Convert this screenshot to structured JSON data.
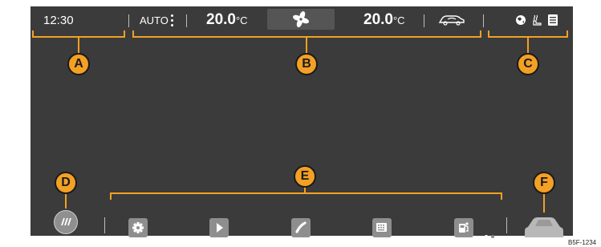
{
  "status_bar": {
    "time": "12:30",
    "auto_label": "AUTO",
    "temp_left_value": "20.0",
    "temp_left_unit": "°C",
    "temp_right_value": "20.0",
    "temp_right_unit": "°C"
  },
  "callouts": {
    "a": "A",
    "b": "B",
    "c": "C",
    "d": "D",
    "e": "E",
    "f": "F"
  },
  "bottom_bar": {
    "apps": [
      "settings-icon",
      "play-icon",
      "phone-icon",
      "keyboard-icon",
      "fuel-icon"
    ],
    "page_dots": {
      "count": 2,
      "active": 1
    }
  },
  "status_icons": [
    "globe-icon",
    "seat-heating-icon",
    "list-icon"
  ],
  "reference_code": "B5F-1234",
  "colors": {
    "screen": "#3b3b3b",
    "callout": "#f4a024",
    "text": "#ffffff",
    "app_button": "#8e8e8e"
  }
}
